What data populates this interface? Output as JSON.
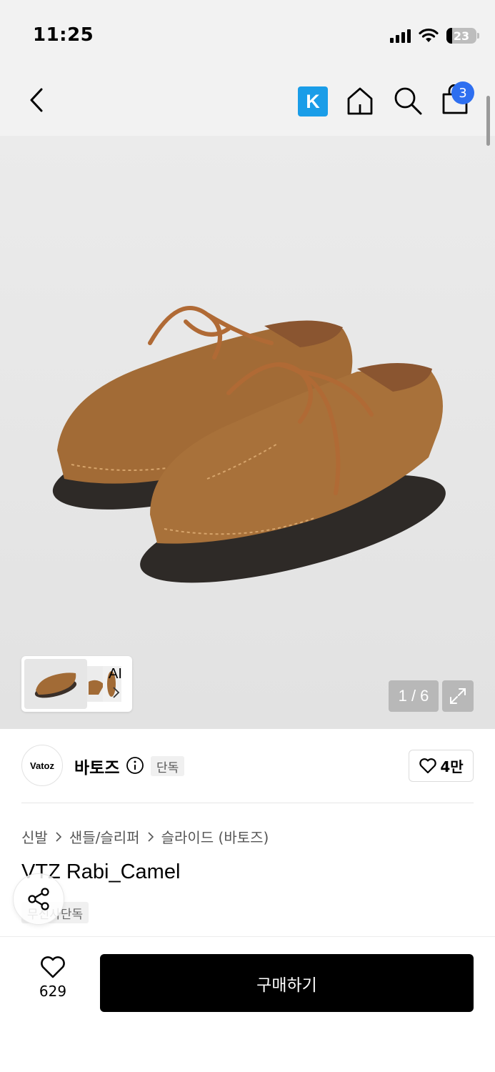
{
  "status_bar": {
    "time": "11:25",
    "battery_level": "23"
  },
  "nav": {
    "k_label": "K",
    "cart_count": "3"
  },
  "gallery": {
    "ai_label": "AI",
    "page_counter": "1 / 6"
  },
  "brand": {
    "logo_text": "Vatoz",
    "name": "바토즈",
    "exclusive_badge": "단독",
    "likes": "4만"
  },
  "breadcrumb": [
    "신발",
    "샌들/슬리퍼",
    "슬라이드 (바토즈)"
  ],
  "product": {
    "title": "VTZ Rabi_Camel",
    "tag": "무신사단독"
  },
  "bottom": {
    "wish_count": "629",
    "buy_label": "구매하기"
  },
  "colors": {
    "k_blue": "#1a9de8",
    "badge_blue": "#2e6ff0",
    "buy_button": "#000000",
    "shoe_suede": "#a26b36"
  },
  "icons": [
    "back-arrow-icon",
    "home-icon",
    "search-icon",
    "cart-icon",
    "info-icon",
    "heart-icon",
    "share-icon",
    "expand-icon",
    "chevron-right-icon"
  ]
}
